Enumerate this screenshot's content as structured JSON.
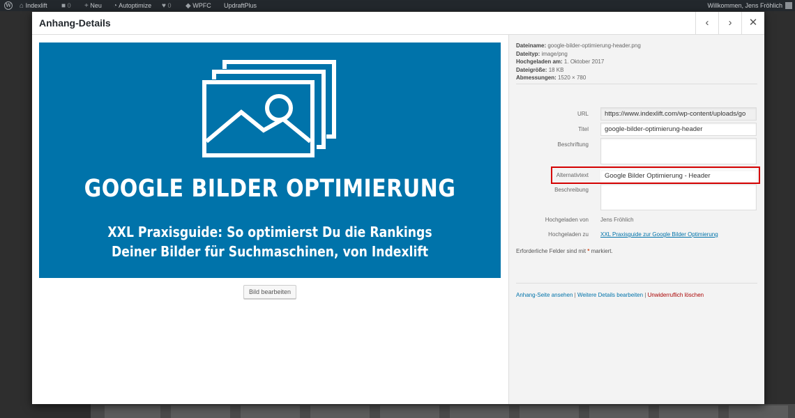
{
  "adminbar": {
    "site": "Indexlift",
    "comments": "0",
    "new": "Neu",
    "autoptimize": "Autoptimize",
    "likes": "0",
    "wpfc": "WPFC",
    "updraft": "UpdraftPlus",
    "welcome": "Willkommen, Jens Fröhlich"
  },
  "modal": {
    "title": "Anhang-Details",
    "prev_icon": "chevron-left-icon",
    "next_icon": "chevron-right-icon",
    "close_icon": "close-icon"
  },
  "preview": {
    "headline": "GOOGLE BILDER OPTIMIERUNG",
    "sub_line1": "XXL Praxisguide: So optimierst Du die Rankings",
    "sub_line2": "Deiner Bilder für Suchmaschinen, von Indexlift",
    "bg_color": "#0073aa",
    "edit_button": "Bild bearbeiten"
  },
  "fileinfo": {
    "filename_label": "Dateiname:",
    "filename": "google-bilder-optimierung-header.png",
    "type_label": "Dateityp:",
    "type": "image/png",
    "uploaded_label": "Hochgeladen am:",
    "uploaded": "1. Oktober 2017",
    "size_label": "Dateigröße:",
    "size": "18 KB",
    "dims_label": "Abmessungen:",
    "dims": "1520 × 780"
  },
  "fields": {
    "url_label": "URL",
    "url": "https://www.indexlift.com/wp-content/uploads/go",
    "title_label": "Titel",
    "title": "google-bilder-optimierung-header",
    "caption_label": "Beschriftung",
    "caption": "",
    "alt_label": "Alternativtext",
    "alt": "Google Bilder Optimierung - Header",
    "desc_label": "Beschreibung",
    "desc": "",
    "uploaded_by_label": "Hochgeladen von",
    "uploaded_by": "Jens Fröhlich",
    "uploaded_to_label": "Hochgeladen zu",
    "uploaded_to": "XXL Praxisguide zur Google Bilder Optimierung"
  },
  "required_note": {
    "text": "Erforderliche Felder sind mit",
    "star": "*",
    "suffix": "markiert."
  },
  "actions": {
    "view": "Anhang-Seite ansehen",
    "edit": "Weitere Details bearbeiten",
    "delete": "Unwiderruflich löschen",
    "separator": "|"
  }
}
